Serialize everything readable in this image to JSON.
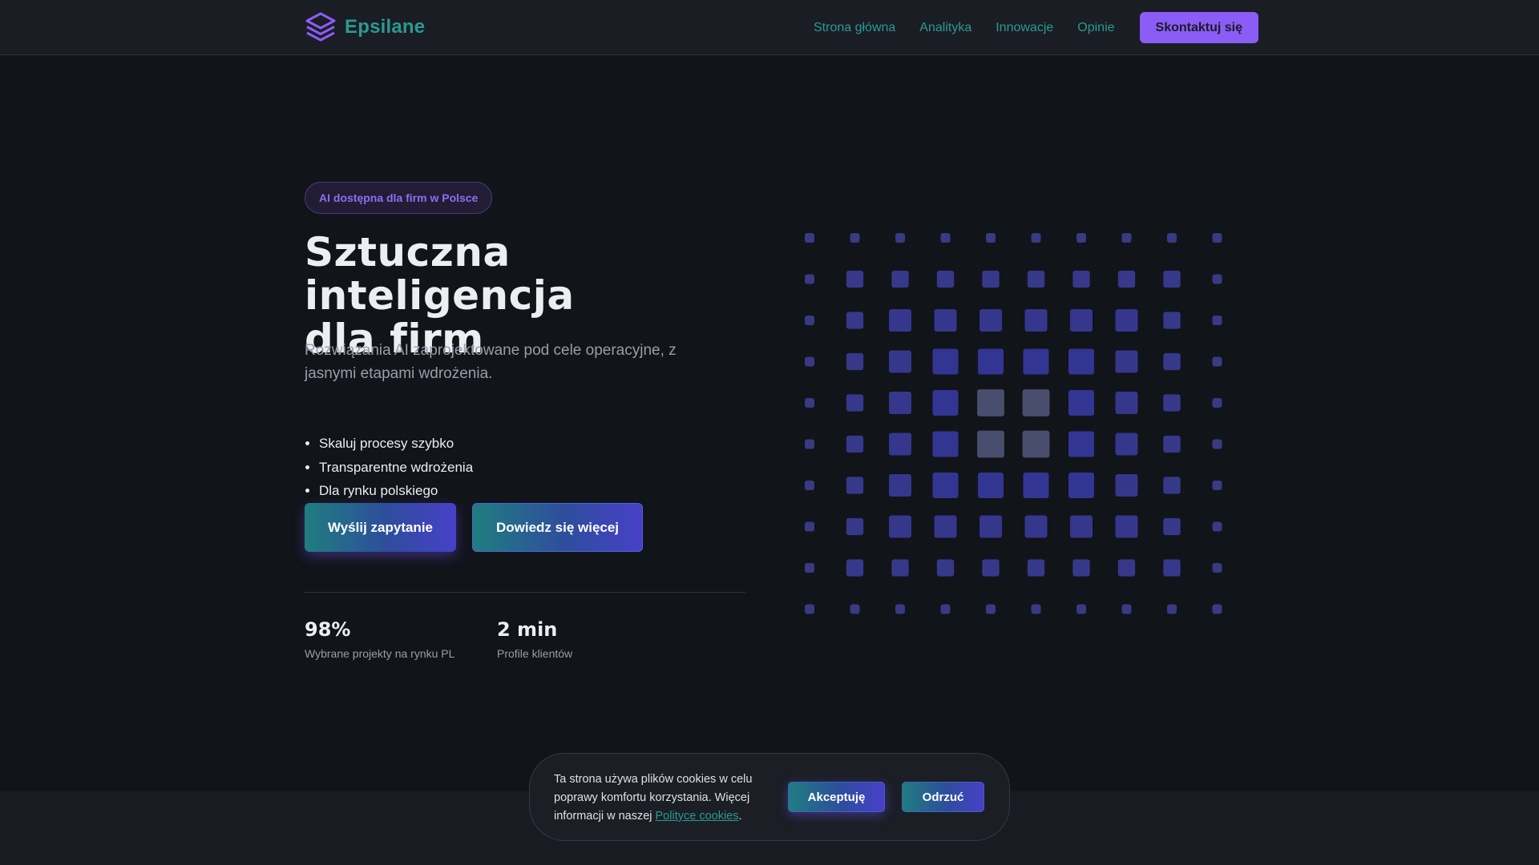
{
  "brand": {
    "name": "Epsilane",
    "logo_icon": "layers-icon",
    "accent": "#8b5cf6",
    "teal": "#2a9a92"
  },
  "nav": {
    "links": [
      "Strona główna",
      "Analityka",
      "Innowacje",
      "Opinie"
    ],
    "cta": "Skontaktuj się"
  },
  "hero": {
    "badge": "AI dostępna dla firm w Polsce",
    "title_line1": "Sztuczna inteligencja",
    "title_line2": "dla firm",
    "subtitle": "Rozwiązania AI zaprojektowane pod cele operacyjne, z jasnymi etapami wdrożenia.",
    "bullets": [
      "Skaluj procesy szybko",
      "Transparentne wdrożenia",
      "Dla rynku polskiego"
    ],
    "primary_button": "Wyślij zapytanie",
    "secondary_button": "Dowiedz się więcej"
  },
  "stats": [
    {
      "value": "98%",
      "label": "Wybrane projekty na rynku PL"
    },
    {
      "value": "2 min",
      "label": "Profile klientów"
    }
  ],
  "cookie": {
    "text_before": "Ta strona używa plików cookies w celu poprawy komfortu korzystania. Więcej informacji w naszej ",
    "link": "Polityce cookies",
    "text_after": ".",
    "accept": "Akceptuję",
    "reject": "Odrzuć"
  }
}
